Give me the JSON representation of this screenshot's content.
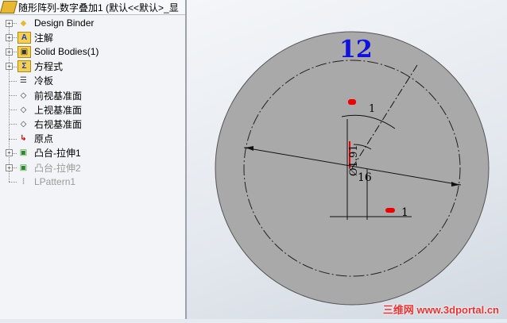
{
  "panel": {
    "title": "随形阵列-数字叠加1 (默认<<默认>_显",
    "items": [
      {
        "label": "Design Binder",
        "icon": "design-binder-icon",
        "expand": true
      },
      {
        "label": "注解",
        "icon": "annotations-icon",
        "expand": true
      },
      {
        "label": "Solid Bodies(1)",
        "icon": "solid-bodies-icon",
        "expand": true
      },
      {
        "label": "方程式",
        "icon": "equations-icon",
        "expand": true
      },
      {
        "label": "冷板",
        "icon": "material-icon",
        "expand": false
      },
      {
        "label": "前视基准面",
        "icon": "plane-icon",
        "expand": false
      },
      {
        "label": "上视基准面",
        "icon": "plane-icon",
        "expand": false
      },
      {
        "label": "右视基准面",
        "icon": "plane-icon",
        "expand": false
      },
      {
        "label": "原点",
        "icon": "origin-icon",
        "expand": false
      },
      {
        "label": "凸台-拉伸1",
        "icon": "extrude-icon",
        "expand": true
      },
      {
        "label": "凸台-拉伸2",
        "icon": "extrude-icon",
        "expand": true,
        "suppressed": true
      },
      {
        "label": "LPattern1",
        "icon": "pattern-icon",
        "expand": false,
        "suppressed": true
      }
    ]
  },
  "viewport": {
    "number_text": "12",
    "dim_diameter": "Ø1.91",
    "dim_16": "16",
    "dim_1": "1",
    "dim_top": "1"
  },
  "watermark": "三维网 www.3dportal.cn"
}
